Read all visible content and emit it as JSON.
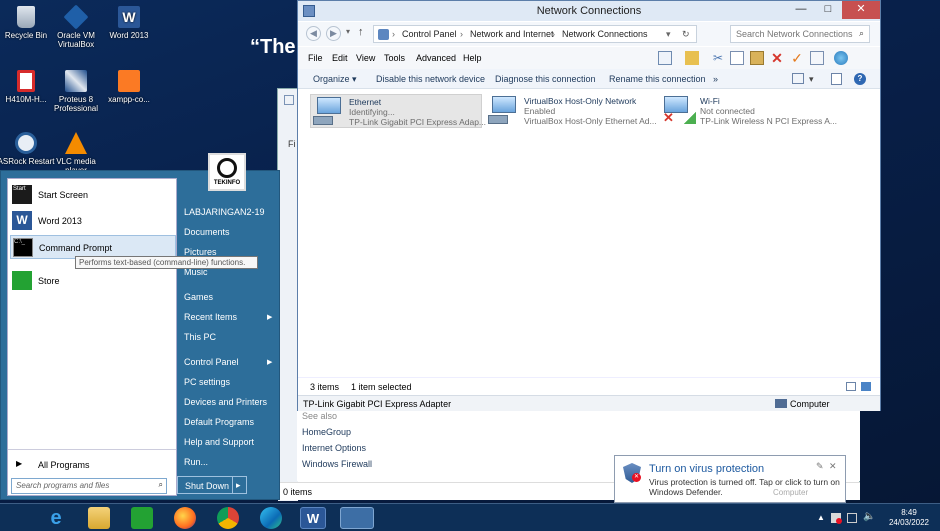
{
  "desktop": {
    "icons": [
      {
        "label": "Recycle Bin",
        "icon": "recycle-bin-icon"
      },
      {
        "label": "Oracle VM VirtualBox",
        "icon": "virtualbox-icon"
      },
      {
        "label": "Word 2013",
        "icon": "word-icon"
      },
      {
        "label": "H410M-H...",
        "icon": "pdf-file-icon"
      },
      {
        "label": "Proteus 8 Professional",
        "icon": "proteus-icon"
      },
      {
        "label": "xampp-co...",
        "icon": "xampp-icon"
      },
      {
        "label": "ASRock Restart",
        "icon": "asrock-icon"
      },
      {
        "label": "VLC media player",
        "icon": "vlc-icon"
      }
    ],
    "headline": "“The"
  },
  "window": {
    "title": "Network Connections",
    "caption": {
      "minimize": "—",
      "maximize": "□",
      "close": "✕"
    },
    "address": {
      "crumbs": [
        "Control Panel",
        "Network and Internet",
        "Network Connections"
      ],
      "search_placeholder": "Search Network Connections"
    },
    "menus": [
      "File",
      "Edit",
      "View",
      "Tools",
      "Advanced",
      "Help"
    ],
    "commands": {
      "organize": "Organize ▾",
      "disable": "Disable this network device",
      "diagnose": "Diagnose this connection",
      "rename": "Rename this connection",
      "more": "»"
    },
    "connections": [
      {
        "name": "Ethernet",
        "status": "Identifying...",
        "adapter": "TP-Link Gigabit PCI Express Adap...",
        "selected": true
      },
      {
        "name": "VirtualBox Host-Only Network",
        "status": "Enabled",
        "adapter": "VirtualBox Host-Only Ethernet Ad...",
        "selected": false
      },
      {
        "name": "Wi-Fi",
        "status": "Not connected",
        "adapter": "TP-Link Wireless N PCI Express A...",
        "selected": false
      }
    ],
    "status": {
      "count": "3 items",
      "selected": "1 item selected"
    },
    "details": {
      "adapter": "TP-Link Gigabit PCI Express Adapter",
      "location": "Computer"
    }
  },
  "back_window": {
    "see_also": "See also",
    "links": [
      "HomeGroup",
      "Internet Options",
      "Windows Firewall"
    ],
    "status": "0 items",
    "side_letter": "Fi"
  },
  "start_menu": {
    "pinned": [
      {
        "label": "Start Screen",
        "icon": "start-screen-icon"
      },
      {
        "label": "Word 2013",
        "icon": "word-icon"
      },
      {
        "label": "Command Prompt",
        "icon": "command-prompt-icon"
      },
      {
        "label": "Store",
        "icon": "store-icon"
      }
    ],
    "all_programs": "All Programs",
    "search_placeholder": "Search programs and files",
    "tooltip": "Performs text-based (command-line) functions.",
    "user_name": "LABJARINGAN2-19",
    "user_pic_label": "TEKINFO",
    "right": [
      "Documents",
      "Pictures",
      "Music",
      "Games",
      "Recent Items",
      "This PC",
      "Control Panel",
      "PC settings",
      "Devices and Printers",
      "Default Programs",
      "Help and Support",
      "Run..."
    ],
    "shutdown": "Shut Down",
    "shutdown_arrow": "▸"
  },
  "notification": {
    "title": "Turn on virus protection",
    "body": "Virus protection is turned off. Tap or click to turn on Windows Defender.",
    "ghost": "Computer"
  },
  "taskbar": {
    "apps": [
      "internet-explorer-icon",
      "file-explorer-icon",
      "store-icon",
      "firefox-icon",
      "chrome-icon",
      "edge-icon",
      "word-icon",
      "network-connections-icon"
    ],
    "time": "8:49",
    "date": "24/03/2022"
  },
  "colors": {
    "accent": "#2d6e9a",
    "link": "#1e395b",
    "alert": "#e81123"
  }
}
